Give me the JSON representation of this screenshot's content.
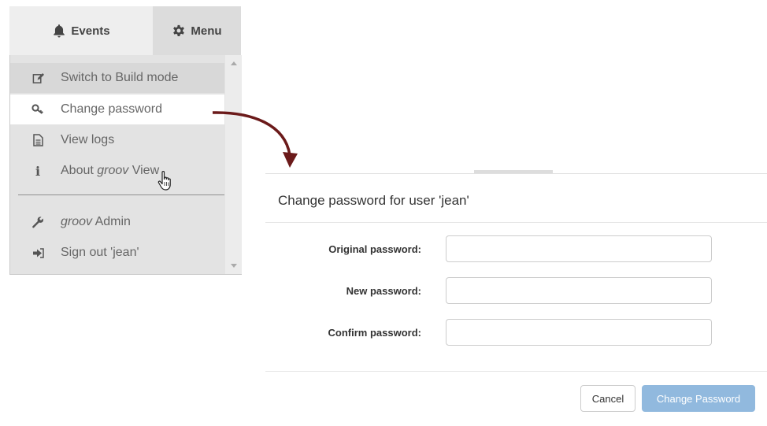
{
  "topbar": {
    "events_label": "Events",
    "menu_label": "Menu"
  },
  "menu": {
    "items": [
      {
        "icon": "edit-icon",
        "label": "Switch to Build mode"
      },
      {
        "icon": "key-icon",
        "label": "Change password"
      },
      {
        "icon": "file-icon",
        "label": "View logs"
      },
      {
        "icon": "info-icon",
        "label_prefix": "About ",
        "label_italic": "groov",
        "label_suffix": " View"
      },
      {
        "icon": "wrench-icon",
        "label_italic": "groov",
        "label_suffix": " Admin"
      },
      {
        "icon": "sign-out-icon",
        "label": "Sign out 'jean'"
      }
    ]
  },
  "dialog": {
    "title": "Change password for user 'jean'",
    "fields": [
      {
        "label": "Original password:",
        "value": ""
      },
      {
        "label": "New password:",
        "value": ""
      },
      {
        "label": "Confirm password:",
        "value": ""
      }
    ],
    "cancel_label": "Cancel",
    "submit_label": "Change Password"
  },
  "colors": {
    "arrow": "#6b1a1a",
    "primary_button": "#91b9de",
    "menu_bg": "#e3e3e3"
  }
}
